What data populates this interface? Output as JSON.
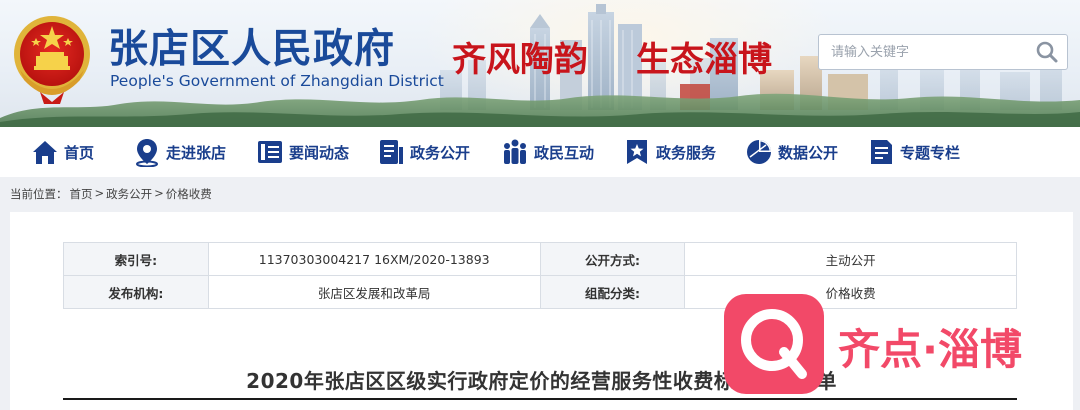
{
  "header": {
    "site_title": "张店区人民政府",
    "site_subtitle": "People's Government of Zhangdian District",
    "slogan_part1": "齐风陶韵",
    "slogan_part2": "生态淄博",
    "search_placeholder": "请输入关键字",
    "emblem_icon": "national-emblem-icon"
  },
  "nav": {
    "items": [
      {
        "label": "首页",
        "icon": "home-icon"
      },
      {
        "label": "走进张店",
        "icon": "location-pin-icon"
      },
      {
        "label": "要闻动态",
        "icon": "news-icon"
      },
      {
        "label": "政务公开",
        "icon": "document-icon"
      },
      {
        "label": "政民互动",
        "icon": "people-icon"
      },
      {
        "label": "政务服务",
        "icon": "bookmark-star-icon"
      },
      {
        "label": "数据公开",
        "icon": "pie-chart-icon"
      },
      {
        "label": "专题专栏",
        "icon": "file-list-icon"
      }
    ],
    "color": "#1a3e8c"
  },
  "breadcrumb": {
    "prefix": "当前位置：",
    "items": [
      "首页",
      "政务公开",
      "价格收费"
    ],
    "separator": ">"
  },
  "meta": {
    "rows": [
      {
        "label1": "索引号:",
        "value1": "11370303004217 16XM/2020-13893",
        "label2": "公开方式:",
        "value2": "主动公开"
      },
      {
        "label1": "发布机构:",
        "value1": "张店区发展和改革局",
        "label2": "组配分类:",
        "value2": "价格收费"
      }
    ]
  },
  "document": {
    "title": "2020年张店区区级实行政府定价的经营服务性收费标准目录清单"
  },
  "watermark": {
    "text": "齐点·淄博",
    "color": "#f24968"
  }
}
